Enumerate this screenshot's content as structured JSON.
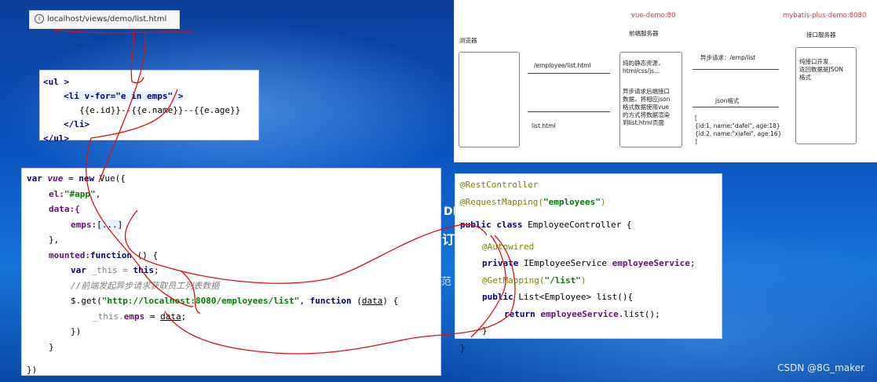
{
  "browser": {
    "url": "localhost/views/demo/list.html"
  },
  "template": {
    "lines": [
      "<ul >",
      "<li v-for=\"e in emps\"  >",
      "{{e.id}}--{{e.name}}--{{e.age}}",
      "</li>",
      "</ul>"
    ]
  },
  "vue_code": {
    "l1": [
      "var",
      "vue",
      " = ",
      "new",
      " Vue({"
    ],
    "l2": [
      "el:",
      "\"#app\"",
      ","
    ],
    "l3": [
      "data:{"
    ],
    "l4": [
      "emps:",
      "[...]"
    ],
    "l5": [
      "},"
    ],
    "l6": [
      "mounted:",
      "function",
      " () {"
    ],
    "l7": [
      "var",
      " _this = ",
      "this",
      ";"
    ],
    "l8": [
      "//前端发起异步请求获取员工列表数据"
    ],
    "l9": [
      "$.get(",
      "\"http://localhost:8080/employees/list\"",
      ",  ",
      "function",
      " (",
      "data",
      ") {"
    ],
    "l10": [
      "_this.",
      "emps",
      " = ",
      "data",
      ";"
    ],
    "l11": [
      "})"
    ],
    "l12": [
      "}"
    ],
    "l13": [
      "})"
    ]
  },
  "diagram": {
    "vue_demo": "vue-demo:80",
    "mybatis_demo": "mybatis-plus-demo:8080",
    "browser_label": "浏览器",
    "frontend_label": "前端服务器",
    "api_label": "接口服务器",
    "req1": "/employee/list.html",
    "resp1": "list.html",
    "front_box_1": "纯的静态资源，\nhtml/css/js...",
    "front_box_2": "异步请求后端接口\n数据，将相应json\n格式数据使用vue\n的方式将数据渲染\n到list.html页面",
    "async_req": "异步请求：/emp/list",
    "json_label": "json格式",
    "json_data": "[\n{id:1, name:\"dafei\", age:18}\n{id:2, name:\"xiafei\", age:16}\n]",
    "api_box": "纯接口开发\n返回数据是JSON\n格式"
  },
  "java_code": {
    "l1": "@RestController",
    "l2": [
      "@RequestMapping(",
      "\"employees\"",
      ")"
    ],
    "l3": [
      "public class",
      " EmployeeController {"
    ],
    "l4": "@Autowired",
    "l5": [
      "private",
      " IEmployeeService ",
      "employeeService",
      ";"
    ],
    "l6": [
      "@GetMapping(",
      "\"/list\"",
      ")"
    ],
    "l7": [
      "public",
      " List<Employee> list(){"
    ],
    "l8": [
      "return",
      " ",
      "employeeService",
      ".list();"
    ],
    "l9": "}",
    "l10": "}"
  },
  "background": {
    "t1": "DIN",
    "t2": "订",
    "t3": "范"
  },
  "watermark": "CSDN @8G_maker"
}
